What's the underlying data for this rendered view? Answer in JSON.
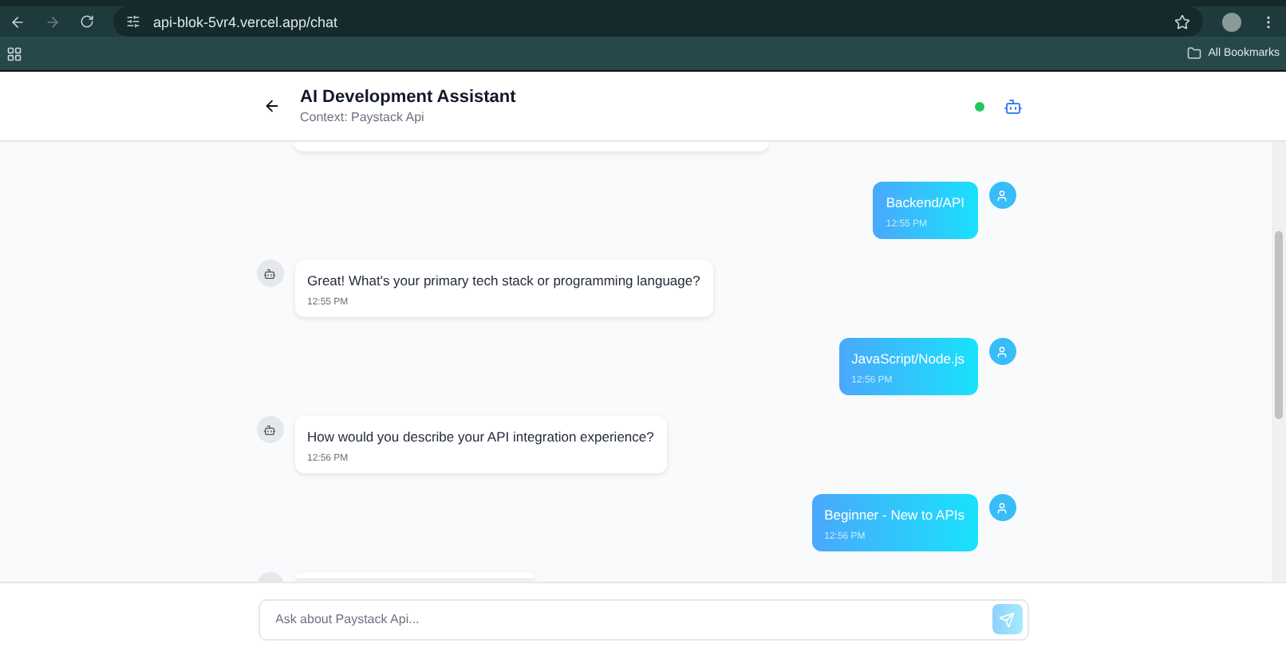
{
  "browser": {
    "url": "api-blok-5vr4.vercel.app/chat",
    "bookmarks_label": "All Bookmarks"
  },
  "header": {
    "title": "AI Development Assistant",
    "subtitle": "Context: Paystack Api"
  },
  "messages": [
    {
      "kind": "user",
      "text": "Backend/API",
      "time": "12:55 PM"
    },
    {
      "kind": "bot",
      "text": "Great! What's your primary tech stack or programming language?",
      "time": "12:55 PM"
    },
    {
      "kind": "user",
      "text": "JavaScript/Node.js",
      "time": "12:56 PM"
    },
    {
      "kind": "bot",
      "text": "How would you describe your API integration experience?",
      "time": "12:56 PM"
    },
    {
      "kind": "user",
      "text": "Beginner - New to APIs",
      "time": "12:56 PM"
    }
  ],
  "composer": {
    "placeholder": "Ask about Paystack Api..."
  }
}
